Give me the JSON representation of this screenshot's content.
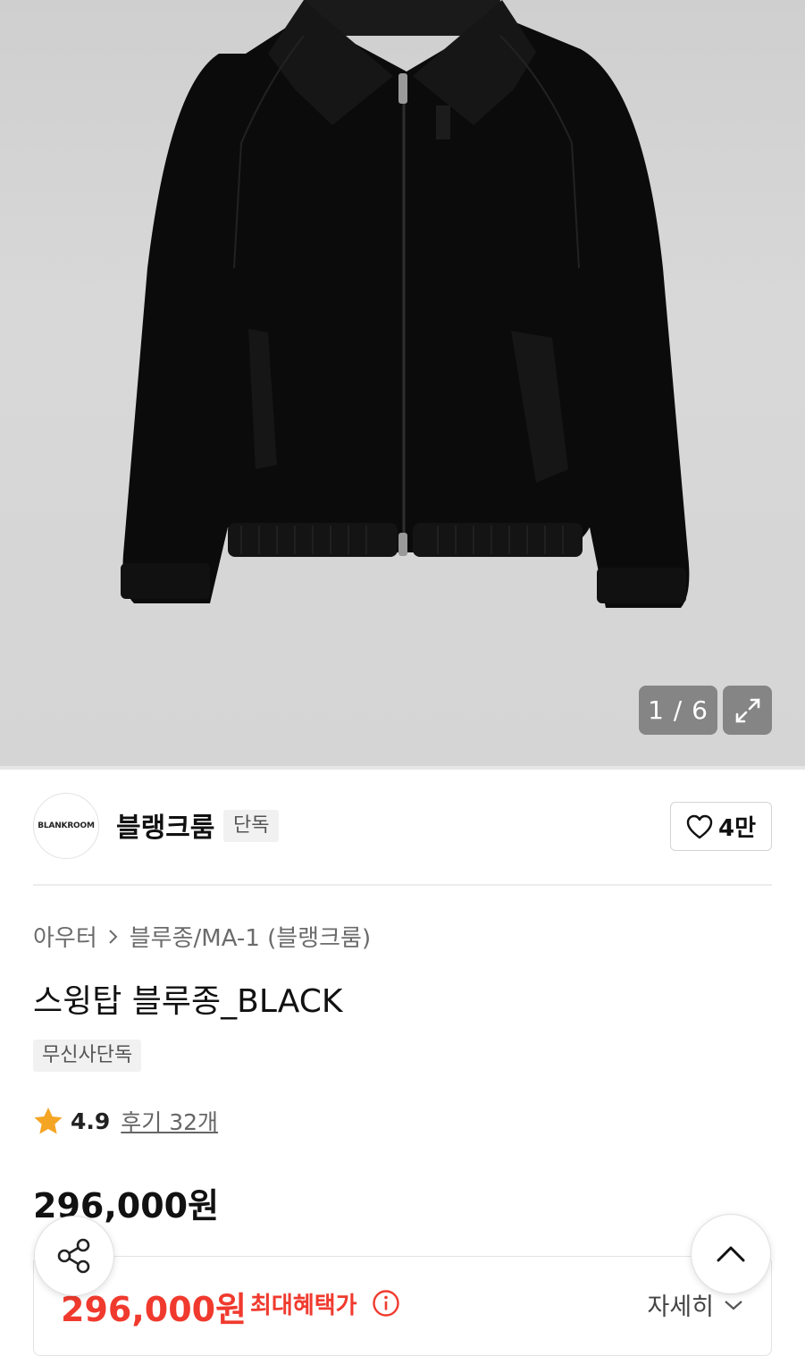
{
  "gallery": {
    "counter": "1 / 6",
    "expand_icon": "expand-icon"
  },
  "brand": {
    "logo_text": "BLANKROOM",
    "name": "블랭크룸",
    "badge": "단독",
    "likes": "4만"
  },
  "breadcrumb": {
    "category": "아우터",
    "subcategory": "블루종/MA-1 (블랭크룸)"
  },
  "product": {
    "title": "스윙탑 블루종_BLACK",
    "tag": "무신사단독",
    "rating": "4.9",
    "reviews": "후기 32개",
    "price": "296,000원"
  },
  "benefit": {
    "price": "296,000원",
    "label": "최대혜택가",
    "detail": "자세히"
  },
  "colors": {
    "accent_red": "#f03a2e",
    "star": "#f5a524"
  }
}
